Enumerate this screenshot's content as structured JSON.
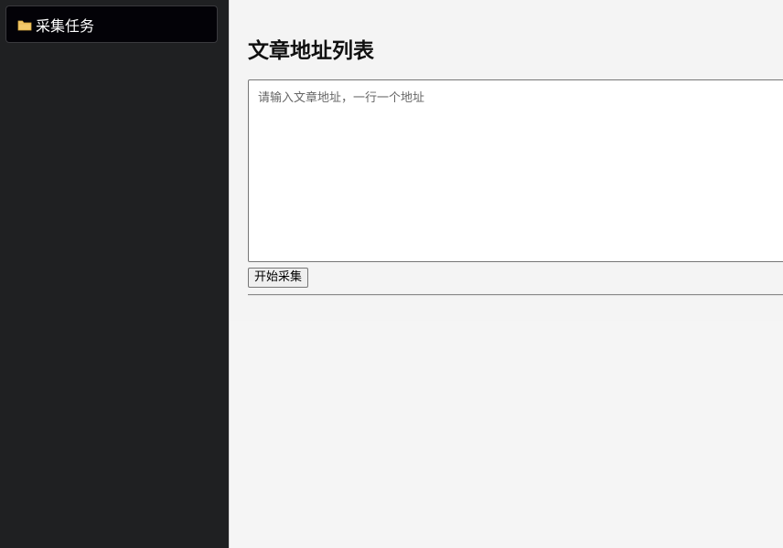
{
  "sidebar": {
    "items": [
      {
        "label": "采集任务",
        "icon": "folder-icon",
        "active": true
      }
    ]
  },
  "main": {
    "title": "文章地址列表",
    "url_input": {
      "value": "",
      "placeholder": "请输入文章地址，一行一个地址"
    },
    "start_button_label": "开始采集"
  },
  "colors": {
    "sidebar_bg": "#1f2022",
    "nav_item_bg": "#030207",
    "main_bg": "#f4f4f4",
    "folder_icon": "#f3c96a"
  }
}
